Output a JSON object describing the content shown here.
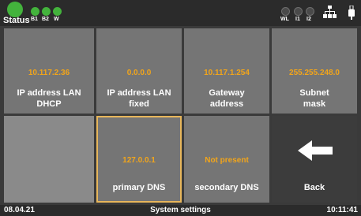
{
  "status_bar": {
    "status_label": "Status",
    "indicators": [
      {
        "label": "B1",
        "state": "green"
      },
      {
        "label": "B2",
        "state": "green"
      },
      {
        "label": "W",
        "state": "green"
      },
      {
        "label": "WL",
        "state": "off"
      },
      {
        "label": "I1",
        "state": "off"
      },
      {
        "label": "I2",
        "state": "off"
      }
    ],
    "icons": [
      "network-icon",
      "usb-icon"
    ]
  },
  "tiles": [
    {
      "value": "10.117.2.36",
      "label_line1": "IP address LAN",
      "label_line2": "DHCP"
    },
    {
      "value": "0.0.0.0",
      "label_line1": "IP address LAN",
      "label_line2": "fixed"
    },
    {
      "value": "10.117.1.254",
      "label_line1": "Gateway",
      "label_line2": "address"
    },
    {
      "value": "255.255.248.0",
      "label_line1": "Subnet",
      "label_line2": "mask"
    },
    {
      "value": "127.0.0.1",
      "label": "primary DNS"
    },
    {
      "value": "Not present",
      "label": "secondary DNS"
    },
    {
      "label": "Back",
      "icon": "arrow-left-icon"
    }
  ],
  "footer": {
    "date": "08.04.21",
    "title": "System settings",
    "time": "10:11:41"
  },
  "colors": {
    "status_green": "#43b33c",
    "value_orange": "#f2a51a",
    "selected_border": "#e7b65b",
    "tile_gray": "#757575",
    "bar_dark": "#2b2b2b"
  }
}
